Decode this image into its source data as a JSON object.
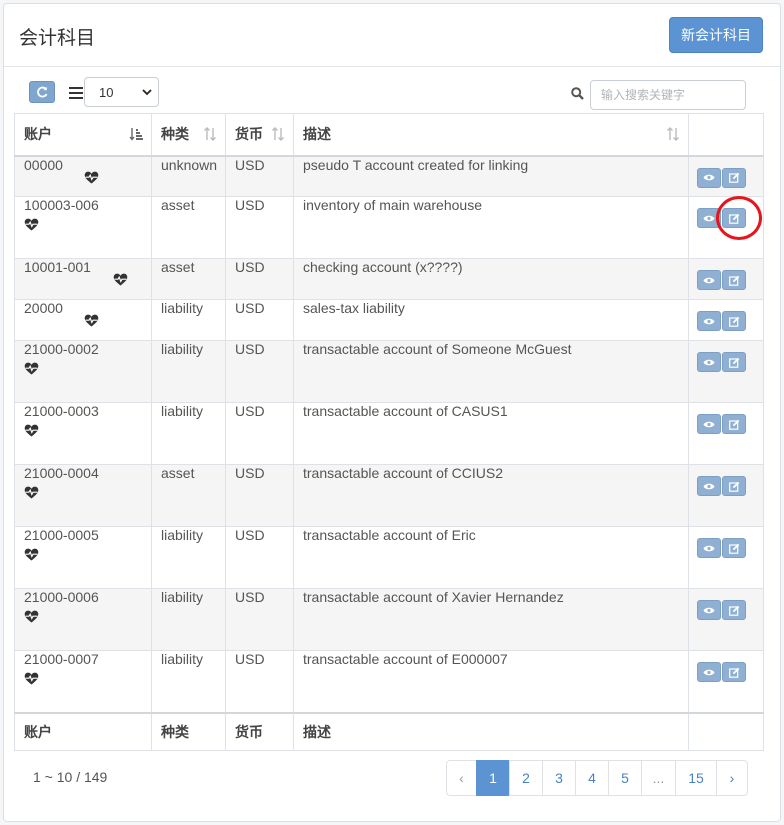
{
  "panel": {
    "title": "会计科目",
    "new_button": "新会计科目"
  },
  "toolbar": {
    "page_size": "10",
    "search_placeholder": "输入搜索关键字"
  },
  "columns": [
    "账户",
    "种类",
    "货币",
    "描述"
  ],
  "rows": [
    {
      "account": "00000",
      "type": "unknown",
      "currency": "USD",
      "description": "pseudo T account created for linking"
    },
    {
      "account": "100003-006",
      "type": "asset",
      "currency": "USD",
      "description": "inventory of main warehouse"
    },
    {
      "account": "10001-001",
      "type": "asset",
      "currency": "USD",
      "description": "checking account (x????)"
    },
    {
      "account": "20000",
      "type": "liability",
      "currency": "USD",
      "description": "sales-tax liability"
    },
    {
      "account": "21000-0002",
      "type": "liability",
      "currency": "USD",
      "description": "transactable account of Someone McGuest"
    },
    {
      "account": "21000-0003",
      "type": "liability",
      "currency": "USD",
      "description": "transactable account of CASUS1"
    },
    {
      "account": "21000-0004",
      "type": "asset",
      "currency": "USD",
      "description": "transactable account of CCIUS2"
    },
    {
      "account": "21000-0005",
      "type": "liability",
      "currency": "USD",
      "description": "transactable account of Eric"
    },
    {
      "account": "21000-0006",
      "type": "liability",
      "currency": "USD",
      "description": "transactable account of Xavier Hernandez"
    },
    {
      "account": "21000-0007",
      "type": "liability",
      "currency": "USD",
      "description": "transactable account of E000007"
    }
  ],
  "footer": {
    "info": "1 ~ 10 / 149"
  },
  "pagination": [
    "‹",
    "1",
    "2",
    "3",
    "4",
    "5",
    "...",
    "15",
    "›"
  ],
  "icons": {
    "row_icon": "heartbeat-icon",
    "view": "eye-icon",
    "edit": "edit-icon",
    "refresh": "refresh-icon",
    "list": "list-icon",
    "search": "search-icon"
  },
  "colors": {
    "primary": "#5b93d3",
    "highlight": "#e8141c"
  }
}
